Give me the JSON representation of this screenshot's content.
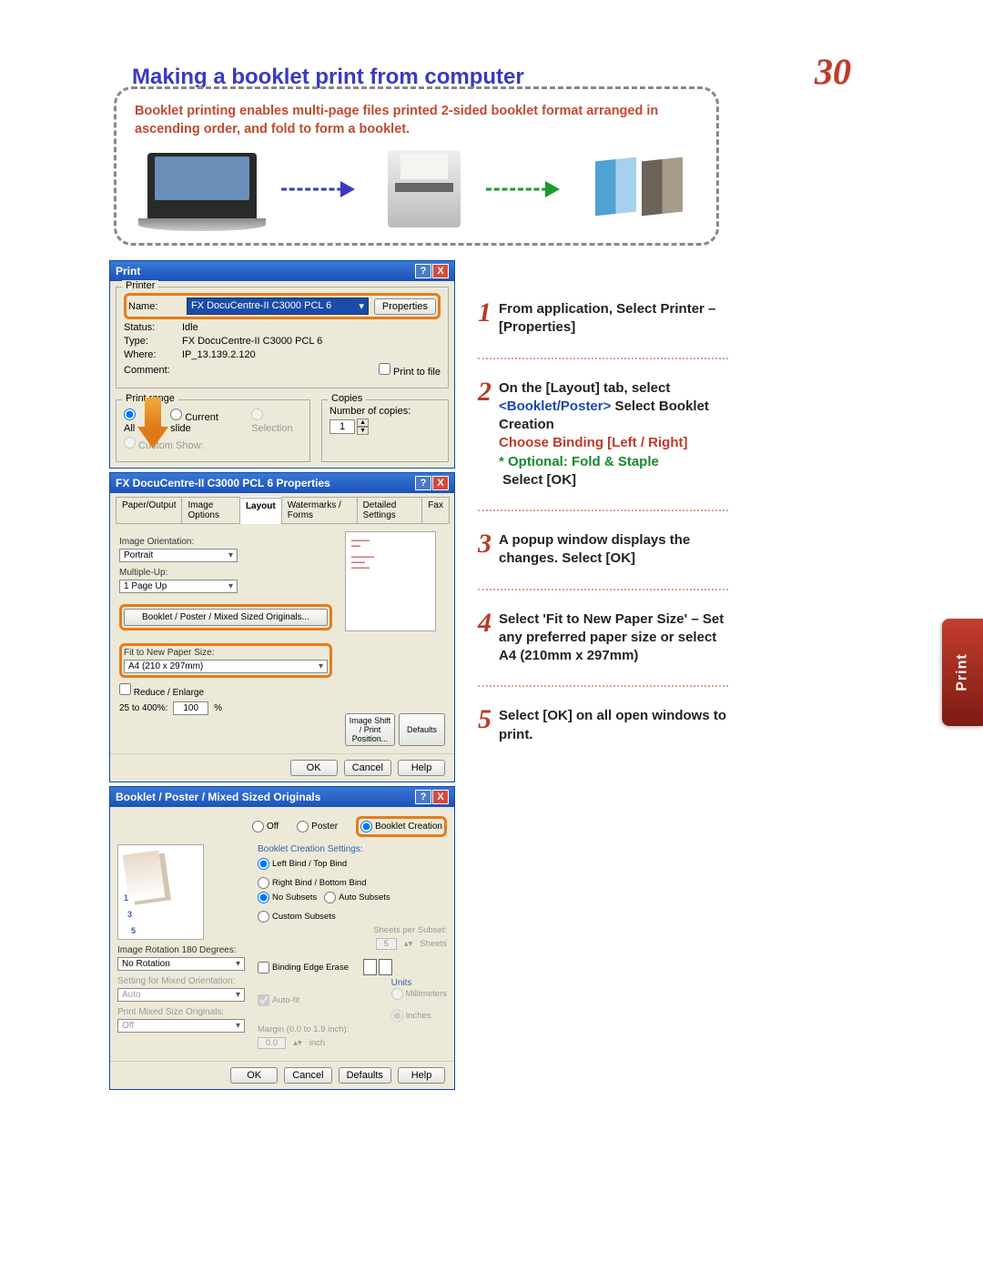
{
  "header": {
    "title": "Making a booklet print from computer",
    "page_num": "30"
  },
  "intro": "Booklet printing enables multi-page files printed 2-sided booklet format arranged in ascending order, and fold to form a booklet.",
  "sidetab": "Print",
  "win1": {
    "title": "Print",
    "grp_printer": "Printer",
    "name_lbl": "Name:",
    "name_val": "FX DocuCentre-II C3000 PCL 6",
    "props_btn": "Properties",
    "status_lbl": "Status:",
    "status_val": "Idle",
    "type_lbl": "Type:",
    "type_val": "FX DocuCentre-II C3000 PCL 6",
    "where_lbl": "Where:",
    "where_val": "IP_13.139.2.120",
    "comment_lbl": "Comment:",
    "ptf": "Print to file",
    "grp_range": "Print range",
    "all": "All",
    "cur": "Current slide",
    "selc": "Selection",
    "show": "Custom Show:",
    "grp_copies": "Copies",
    "ncopies": "Number of copies:",
    "one": "1"
  },
  "win2": {
    "title": "FX DocuCentre-II C3000 PCL 6 Properties",
    "tabs": [
      "Paper/Output",
      "Image Options",
      "Layout",
      "Watermarks / Forms",
      "Detailed Settings",
      "Fax"
    ],
    "orient_lbl": "Image Orientation:",
    "orient": "Portrait",
    "mult_lbl": "Multiple-Up:",
    "mult": "1 Page Up",
    "bp_btn": "Booklet / Poster / Mixed Sized Originals...",
    "fit_lbl": "Fit to New Paper Size:",
    "fit": "A4 (210 x 297mm)",
    "re_chk": "Reduce / Enlarge",
    "re_lbl": "25 to 400%:",
    "re_val": "100",
    "pct": "%",
    "shift_btn": "Image Shift / Print Position...",
    "def": "Defaults",
    "ok": "OK",
    "cancel": "Cancel",
    "help": "Help"
  },
  "win3": {
    "title": "Booklet / Poster / Mixed Sized Originals",
    "r_off": "Off",
    "r_poster": "Poster",
    "r_bc": "Booklet Creation",
    "set_ttl": "Booklet Creation Settings:",
    "lb": "Left Bind / Top Bind",
    "rb": "Right Bind / Bottom Bind",
    "ns": "No Subsets",
    "as": "Auto Subsets",
    "cs": "Custom Subsets",
    "sps": "Sheets per Subset:",
    "sheets": "Sheets",
    "rot_lbl": "Image Rotation 180 Degrees:",
    "rot": "No Rotation",
    "mix_lbl": "Setting for Mixed Orientation:",
    "mix": "Auto",
    "pms_lbl": "Print Mixed Size Originals:",
    "pms": "Off",
    "be": "Binding Edge Erase",
    "af": "Auto-fit",
    "mar": "Margin (0.0 to 1.9 inch):",
    "mv": "0.0",
    "mi": "inch",
    "units": "Units",
    "mm": "Millimeters",
    "in": "Inches",
    "p1": "1",
    "p3": "3",
    "p5": "5",
    "ok": "OK",
    "cancel": "Cancel",
    "def": "Defaults",
    "help": "Help"
  },
  "steps": {
    "s1": {
      "n": "1",
      "t1": "From application, Select Printer – [Properties]"
    },
    "s2": {
      "n": "2",
      "t1": "On the [Layout] tab, select ",
      "bp": "<Booklet/Poster>",
      "t2": " Select Booklet Creation",
      "red": "Choose Binding [Left / Right]",
      "grn": "* Optional: Fold & Staple",
      "t3": "Select [OK]"
    },
    "s3": {
      "n": "3",
      "t1": "A popup window displays the changes. Select [OK]"
    },
    "s4": {
      "n": "4",
      "t1": "Select 'Fit to New Paper Size' – Set any preferred paper size or select A4 (210mm x 297mm)"
    },
    "s5": {
      "n": "5",
      "t1": "Select [OK] on all open windows to print."
    }
  }
}
